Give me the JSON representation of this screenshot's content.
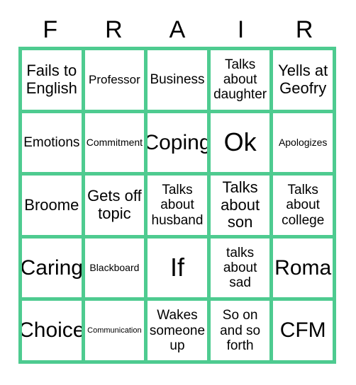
{
  "card": {
    "title_letters": [
      "F",
      "R",
      "A",
      "I",
      "R"
    ],
    "grid_color": "#4ECB90",
    "cell_background": "#ffffff",
    "text_color": "#000000",
    "rows": 5,
    "columns": 5,
    "cells": [
      {
        "text": "Fails to English",
        "size": "xl"
      },
      {
        "text": "Professor",
        "size": "md"
      },
      {
        "text": "Business",
        "size": "lg"
      },
      {
        "text": "Talks about daughter",
        "size": "lg"
      },
      {
        "text": "Yells at Geofry",
        "size": "xl"
      },
      {
        "text": "Emotions",
        "size": "lg"
      },
      {
        "text": "Commitment",
        "size": "sm"
      },
      {
        "text": "Coping",
        "size": "xxl"
      },
      {
        "text": "Ok",
        "size": "huge"
      },
      {
        "text": "Apologizes",
        "size": "sm"
      },
      {
        "text": "Broome",
        "size": "xl"
      },
      {
        "text": "Gets off topic",
        "size": "xl"
      },
      {
        "text": "Talks about husband",
        "size": "lg"
      },
      {
        "text": "Talks about son",
        "size": "xl"
      },
      {
        "text": "Talks about college",
        "size": "lg"
      },
      {
        "text": "Caring",
        "size": "xxl"
      },
      {
        "text": "Blackboard",
        "size": "sm"
      },
      {
        "text": "If",
        "size": "huge"
      },
      {
        "text": "talks about sad",
        "size": "lg"
      },
      {
        "text": "Roma",
        "size": "xxl"
      },
      {
        "text": "Choice",
        "size": "xxl"
      },
      {
        "text": "Communication",
        "size": "xs"
      },
      {
        "text": "Wakes someone up",
        "size": "lg"
      },
      {
        "text": "So on and so forth",
        "size": "lg"
      },
      {
        "text": "CFM",
        "size": "xxl"
      }
    ]
  }
}
